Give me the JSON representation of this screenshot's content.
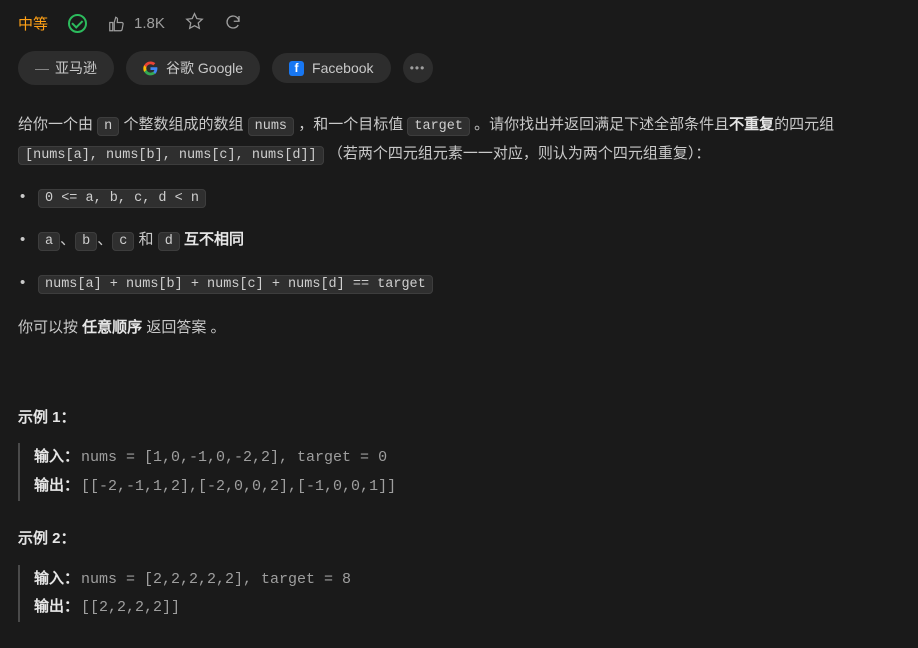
{
  "topbar": {
    "difficulty": "中等",
    "likes": "1.8K"
  },
  "tags": {
    "t1_prefix": "—",
    "t1": "亚马逊",
    "t2": "谷歌 Google",
    "t3": "Facebook"
  },
  "description": {
    "p1_a": "给你一个由 ",
    "c_n": "n",
    "p1_b": " 个整数组成的数组 ",
    "c_nums": "nums",
    "p1_c": " ，和一个目标值 ",
    "c_target": "target",
    "p1_d": " 。请你找出并返回满足下述全部条件且",
    "bold1": "不重复",
    "p1_e": "的四元组 ",
    "c_quad": "[nums[a], nums[b], nums[c], nums[d]]",
    "p1_f": " （若两个四元组元素一一对应，则认为两个四元组重复）："
  },
  "conditions": {
    "c1": "0 <= a, b, c, d < n",
    "c2_a": "a",
    "c2_sep1": "、",
    "c2_b": "b",
    "c2_sep2": "、",
    "c2_c": "c",
    "c2_and": " 和 ",
    "c2_d": "d",
    "c2_tail": " ",
    "c2_bold": "互不相同",
    "c3": "nums[a] + nums[b] + nums[c] + nums[d] == target"
  },
  "closing": {
    "a": "你可以按 ",
    "bold": "任意顺序",
    "b": " 返回答案 。"
  },
  "ex1": {
    "title": "示例 1：",
    "in_label": "输入：",
    "in_val": "nums = [1,0,-1,0,-2,2], target = 0",
    "out_label": "输出：",
    "out_val": "[[-2,-1,1,2],[-2,0,0,2],[-1,0,0,1]]"
  },
  "ex2": {
    "title": "示例 2：",
    "in_label": "输入：",
    "in_val": "nums = [2,2,2,2,2], target = 8",
    "out_label": "输出：",
    "out_val": "[[2,2,2,2]]"
  }
}
